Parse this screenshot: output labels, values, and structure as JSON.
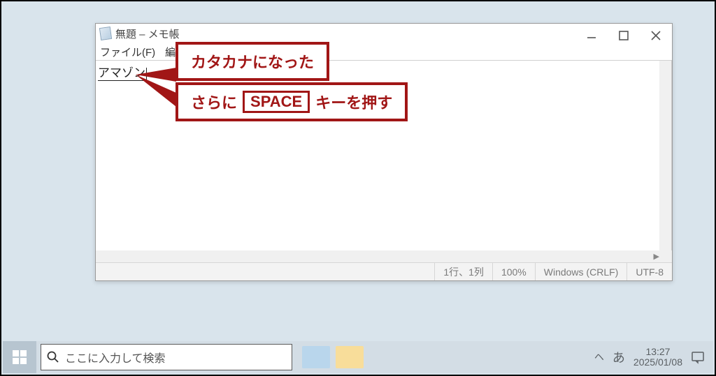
{
  "window": {
    "title": "無題  – メモ帳",
    "menu": {
      "file": "ファイル(F)",
      "edit": "編集(E"
    },
    "text": "アマゾン",
    "status": {
      "position": "1行、1列",
      "zoom": "100%",
      "lineEnding": "Windows (CRLF)",
      "encoding": "UTF-8"
    }
  },
  "callouts": {
    "c1": "カタカナになった",
    "c2_pre": "さらに",
    "c2_key": "SPACE",
    "c2_post": "キーを押す"
  },
  "taskbar": {
    "searchPlaceholder": "ここに入力して検索",
    "ime": "あ",
    "time": "13:27",
    "date": "2025/01/08"
  }
}
